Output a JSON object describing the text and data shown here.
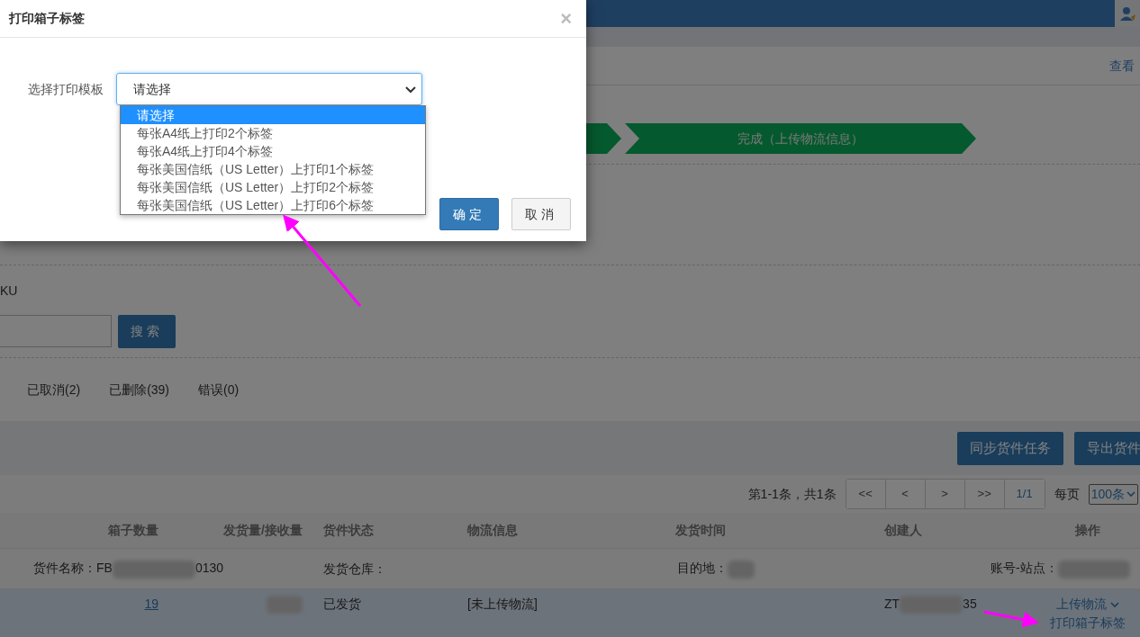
{
  "top_link": "查看",
  "steps": [
    {
      "label": "完成（上传物流信息）",
      "done": true
    }
  ],
  "search": {
    "field_label": "KU",
    "button": "搜索"
  },
  "status_tabs": [
    {
      "label": "已取消(2)",
      "selected": false
    },
    {
      "label": "已删除(39)",
      "selected": false
    },
    {
      "label": "错误(0)",
      "selected": false
    }
  ],
  "toolbar_buttons": [
    "同步货件任务",
    "导出货件"
  ],
  "pagination": {
    "summary": "第1-1条，共1条",
    "buttons": [
      "<<",
      "<",
      ">",
      ">>"
    ],
    "page": "1/1",
    "per_page_label": "每页",
    "per_page": "100条"
  },
  "table": {
    "columns": [
      "箱子数量",
      "发货量/接收量",
      "货件状态",
      "物流信息",
      "发货时间",
      "创建人",
      "操作"
    ],
    "groups": [
      {
        "name_label": "货件名称：",
        "name_start": "FB",
        "name_end": "0130",
        "warehouse_label": "发货仓库：",
        "destination_label": "目的地：",
        "account_label": "账号-站点：",
        "rows": [
          {
            "boxes": "19",
            "status": "已发货",
            "logistics": "[未上传物流]",
            "creator_start": "ZT",
            "creator_end": "35",
            "actions": [
              "上传物流",
              "打印箱子标签"
            ]
          }
        ]
      }
    ]
  },
  "dialog": {
    "title": "打印箱子标签",
    "close": "×",
    "field_label": "选择打印模板",
    "select_value": "请选择",
    "expanded": true,
    "options": [
      {
        "label": "请选择",
        "selected": true
      },
      {
        "label": "每张A4纸上打印2个标签",
        "selected": false
      },
      {
        "label": "每张A4纸上打印4个标签",
        "selected": false
      },
      {
        "label": "每张美国信纸（US Letter）上打印1个标签",
        "selected": false
      },
      {
        "label": "每张美国信纸（US Letter）上打印2个标签",
        "selected": false
      },
      {
        "label": "每张美国信纸（US Letter）上打印6个标签",
        "selected": false
      }
    ],
    "buttons": [
      {
        "label": "确定",
        "kind": "primary"
      },
      {
        "label": "取消",
        "kind": "default"
      }
    ]
  }
}
